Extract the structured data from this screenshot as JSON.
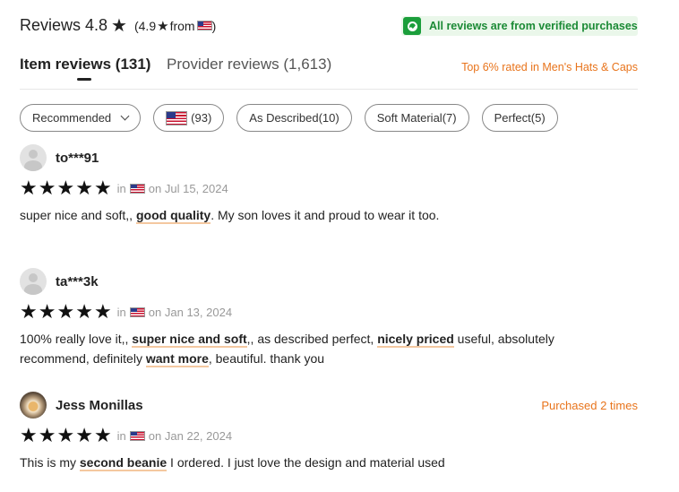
{
  "header": {
    "title": "Reviews 4.8",
    "sub_rating": "(4.9",
    "sub_from": "from",
    "sub_close": ")",
    "verified_text": "All reviews are from verified purchases"
  },
  "tabs": {
    "item_reviews": "Item reviews (131)",
    "provider_reviews": "Provider reviews (1,613)",
    "top_rank": "Top 6% rated in Men's Hats & Caps"
  },
  "filters": {
    "sort": "Recommended",
    "country_count": "(93)",
    "tag1": "As Described(10)",
    "tag2": "Soft Material(7)",
    "tag3": "Perfect(5)"
  },
  "reviews": [
    {
      "user": "to***91",
      "rating": 5,
      "in": "in",
      "date": "on Jul 15, 2024",
      "parts": [
        "super nice and soft,, ",
        "good quality",
        ". My son loves it and proud to wear it too."
      ]
    },
    {
      "user": "ta***3k",
      "rating": 5,
      "in": "in",
      "date": "on Jan 13, 2024",
      "parts": [
        "100% really love it,, ",
        "super nice and soft",
        ",, as described perfect, ",
        "nicely priced",
        " useful, absolutely recommend, definitely ",
        "want more",
        ", beautiful. thank you"
      ]
    },
    {
      "user": "Jess Monillas",
      "purchased": "Purchased 2 times",
      "rating": 5,
      "in": "in",
      "date": "on Jan 22, 2024",
      "parts": [
        "This is my ",
        "second beanie",
        " I ordered. I just love the design and material used"
      ]
    }
  ],
  "icons": {
    "star": "★",
    "shield": "shield-check-icon",
    "flag": "us-flag-icon"
  },
  "colors": {
    "accent_orange": "#e8741c",
    "verified_green": "#1b9e3b",
    "highlight_underline": "#f4c8a0"
  }
}
